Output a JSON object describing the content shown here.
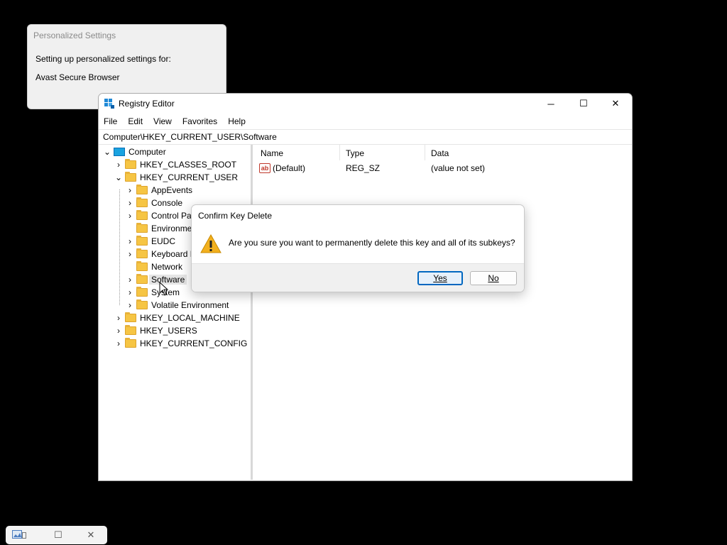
{
  "personalized": {
    "title": "Personalized Settings",
    "line1": "Setting up personalized settings for:",
    "line2": "Avast Secure Browser"
  },
  "registry": {
    "title": "Registry Editor",
    "controls": {
      "minimize": "─",
      "maximize": "☐",
      "close": "✕"
    },
    "menu": [
      "File",
      "Edit",
      "View",
      "Favorites",
      "Help"
    ],
    "address": "Computer\\HKEY_CURRENT_USER\\Software",
    "tree": {
      "root": "Computer",
      "hkcr": "HKEY_CLASSES_ROOT",
      "hkcu": "HKEY_CURRENT_USER",
      "hkcu_children": [
        "AppEvents",
        "Console",
        "Control Pa",
        "Environme",
        "EUDC",
        "Keyboard L",
        "Network",
        "Software",
        "System",
        "Volatile Environment"
      ],
      "hklm": "HKEY_LOCAL_MACHINE",
      "hku": "HKEY_USERS",
      "hkcc": "HKEY_CURRENT_CONFIG"
    },
    "columns": {
      "name": "Name",
      "type": "Type",
      "data": "Data"
    },
    "values": [
      {
        "icon": "ab",
        "name": "(Default)",
        "type": "REG_SZ",
        "data": "(value not set)"
      }
    ]
  },
  "dialog": {
    "title": "Confirm Key Delete",
    "message": "Are you sure you want to permanently delete this key and all of its subkeys?",
    "yes": "Yes",
    "no": "No"
  },
  "colors": {
    "accent": "#0067c0",
    "folder": "#f6c544",
    "warning": "#f2b01e"
  }
}
